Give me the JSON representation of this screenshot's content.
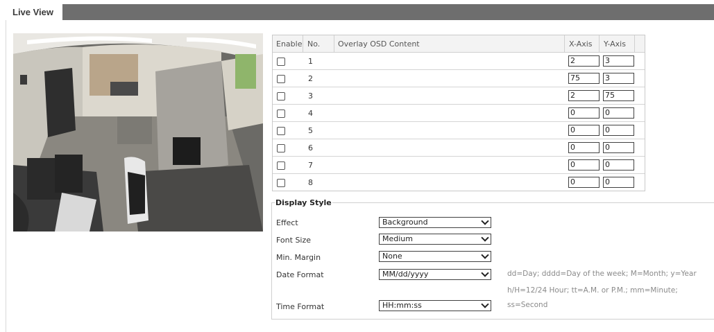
{
  "tabs": {
    "live_view": "Live View"
  },
  "osd_table": {
    "headers": {
      "enable": "Enable",
      "no": "No.",
      "content": "Overlay OSD Content",
      "x_axis": "X-Axis",
      "y_axis": "Y-Axis"
    },
    "rows": [
      {
        "no": "1",
        "x": "2",
        "y": "3"
      },
      {
        "no": "2",
        "x": "75",
        "y": "3"
      },
      {
        "no": "3",
        "x": "2",
        "y": "75"
      },
      {
        "no": "4",
        "x": "0",
        "y": "0"
      },
      {
        "no": "5",
        "x": "0",
        "y": "0"
      },
      {
        "no": "6",
        "x": "0",
        "y": "0"
      },
      {
        "no": "7",
        "x": "0",
        "y": "0"
      },
      {
        "no": "8",
        "x": "0",
        "y": "0"
      }
    ]
  },
  "display_style": {
    "title": "Display Style",
    "effect_label": "Effect",
    "effect_value": "Background",
    "font_size_label": "Font Size",
    "font_size_value": "Medium",
    "min_margin_label": "Min. Margin",
    "min_margin_value": "None",
    "date_format_label": "Date Format",
    "date_format_value": "MM/dd/yyyy",
    "time_format_label": "Time Format",
    "time_format_value": "HH:mm:ss",
    "hint_line1": "dd=Day; dddd=Day of the week; M=Month; y=Year",
    "hint_line2": "h/H=12/24 Hour; tt=A.M. or P.M.; mm=Minute;",
    "hint_line3": "ss=Second"
  }
}
